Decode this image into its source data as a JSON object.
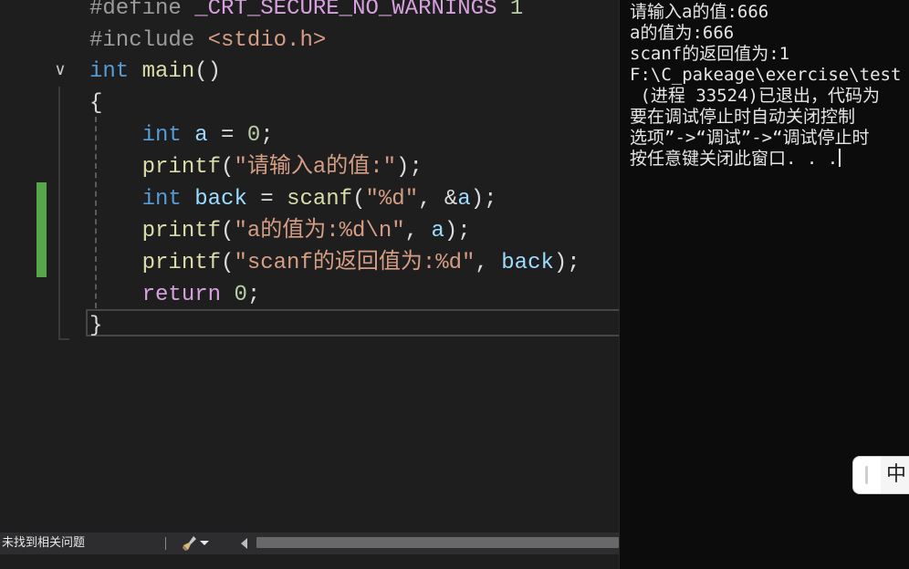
{
  "editor": {
    "lines": [
      {
        "tokens": [
          {
            "c": "pp",
            "t": "#define"
          },
          {
            "c": "punc",
            "t": " "
          },
          {
            "c": "ctl",
            "t": "_CRT_SECURE_NO_WARNINGS"
          },
          {
            "c": "punc",
            "t": " "
          },
          {
            "c": "num",
            "t": "1"
          }
        ]
      },
      {
        "tokens": [
          {
            "c": "pp",
            "t": "#include"
          },
          {
            "c": "punc",
            "t": " "
          },
          {
            "c": "str",
            "t": "<stdio.h>"
          }
        ]
      },
      {
        "tokens": [
          {
            "c": "kw",
            "t": "int"
          },
          {
            "c": "punc",
            "t": " "
          },
          {
            "c": "fn",
            "t": "main"
          },
          {
            "c": "punc",
            "t": "()"
          }
        ]
      },
      {
        "tokens": [
          {
            "c": "punc",
            "t": "{"
          }
        ]
      },
      {
        "tokens": [
          {
            "c": "punc",
            "t": "    "
          },
          {
            "c": "kw",
            "t": "int"
          },
          {
            "c": "punc",
            "t": " "
          },
          {
            "c": "var",
            "t": "a"
          },
          {
            "c": "punc",
            "t": " = "
          },
          {
            "c": "num",
            "t": "0"
          },
          {
            "c": "punc",
            "t": ";"
          }
        ]
      },
      {
        "tokens": [
          {
            "c": "punc",
            "t": "    "
          },
          {
            "c": "fn",
            "t": "printf"
          },
          {
            "c": "punc",
            "t": "("
          },
          {
            "c": "str",
            "t": "\"请输入a的值:\""
          },
          {
            "c": "punc",
            "t": ");"
          }
        ]
      },
      {
        "tokens": [
          {
            "c": "punc",
            "t": "    "
          },
          {
            "c": "kw",
            "t": "int"
          },
          {
            "c": "punc",
            "t": " "
          },
          {
            "c": "var",
            "t": "back"
          },
          {
            "c": "punc",
            "t": " = "
          },
          {
            "c": "fn",
            "t": "scanf"
          },
          {
            "c": "punc",
            "t": "("
          },
          {
            "c": "str",
            "t": "\"%d\""
          },
          {
            "c": "punc",
            "t": ", &"
          },
          {
            "c": "var",
            "t": "a"
          },
          {
            "c": "punc",
            "t": ");"
          }
        ]
      },
      {
        "tokens": [
          {
            "c": "punc",
            "t": "    "
          },
          {
            "c": "fn",
            "t": "printf"
          },
          {
            "c": "punc",
            "t": "("
          },
          {
            "c": "str",
            "t": "\"a的值为:%d\\n\""
          },
          {
            "c": "punc",
            "t": ", "
          },
          {
            "c": "var",
            "t": "a"
          },
          {
            "c": "punc",
            "t": ");"
          }
        ]
      },
      {
        "tokens": [
          {
            "c": "punc",
            "t": "    "
          },
          {
            "c": "fn",
            "t": "printf"
          },
          {
            "c": "punc",
            "t": "("
          },
          {
            "c": "str",
            "t": "\"scanf的返回值为:%d\""
          },
          {
            "c": "punc",
            "t": ", "
          },
          {
            "c": "var",
            "t": "back"
          },
          {
            "c": "punc",
            "t": ");"
          }
        ]
      },
      {
        "tokens": [
          {
            "c": "punc",
            "t": "    "
          },
          {
            "c": "ctl",
            "t": "return"
          },
          {
            "c": "punc",
            "t": " "
          },
          {
            "c": "num",
            "t": "0"
          },
          {
            "c": "punc",
            "t": ";"
          }
        ]
      },
      {
        "tokens": [
          {
            "c": "punc",
            "t": "}"
          }
        ]
      }
    ]
  },
  "statusbar": {
    "issues_text": "未找到相关问题"
  },
  "console": {
    "lines": [
      "请输入a的值:666",
      "a的值为:666",
      "scanf的返回值为:1",
      "F:\\C_pakeage\\exercise\\test",
      " (进程 33524)已退出，代码为",
      "要在调试停止时自动关闭控制",
      "选项”->“调试”->“调试停止时",
      "按任意键关闭此窗口. . ."
    ]
  },
  "ime": {
    "mode_label": "中"
  }
}
